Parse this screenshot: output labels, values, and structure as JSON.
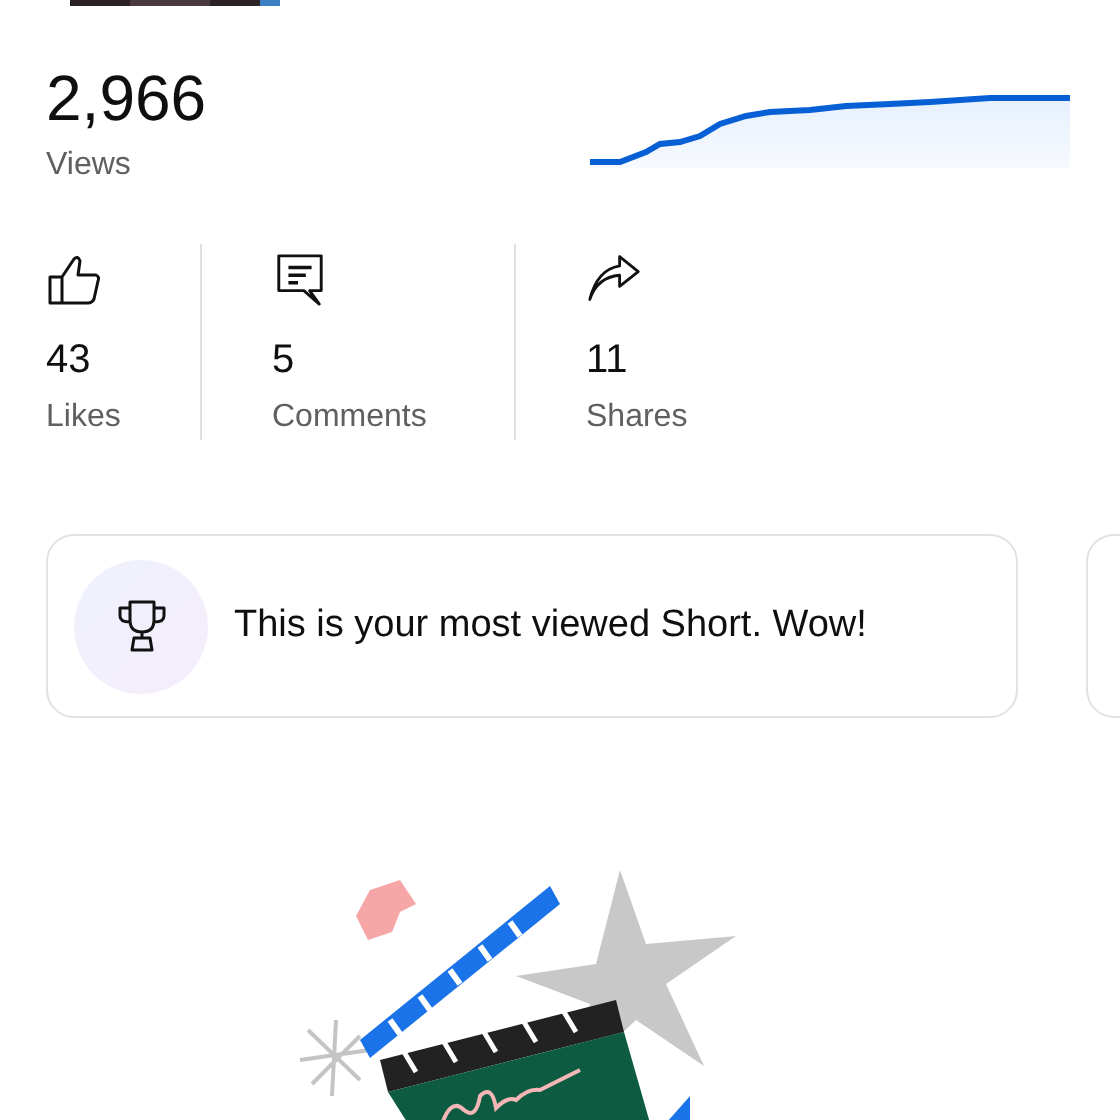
{
  "views": {
    "count": "2,966",
    "label": "Views"
  },
  "stats": [
    {
      "kind": "like",
      "count": "43",
      "label": "Likes"
    },
    {
      "kind": "comment",
      "count": "5",
      "label": "Comments"
    },
    {
      "kind": "share",
      "count": "11",
      "label": "Shares"
    }
  ],
  "highlights": [
    {
      "kind": "trophy",
      "text": "This is your most viewed Short. Wow!"
    }
  ]
}
